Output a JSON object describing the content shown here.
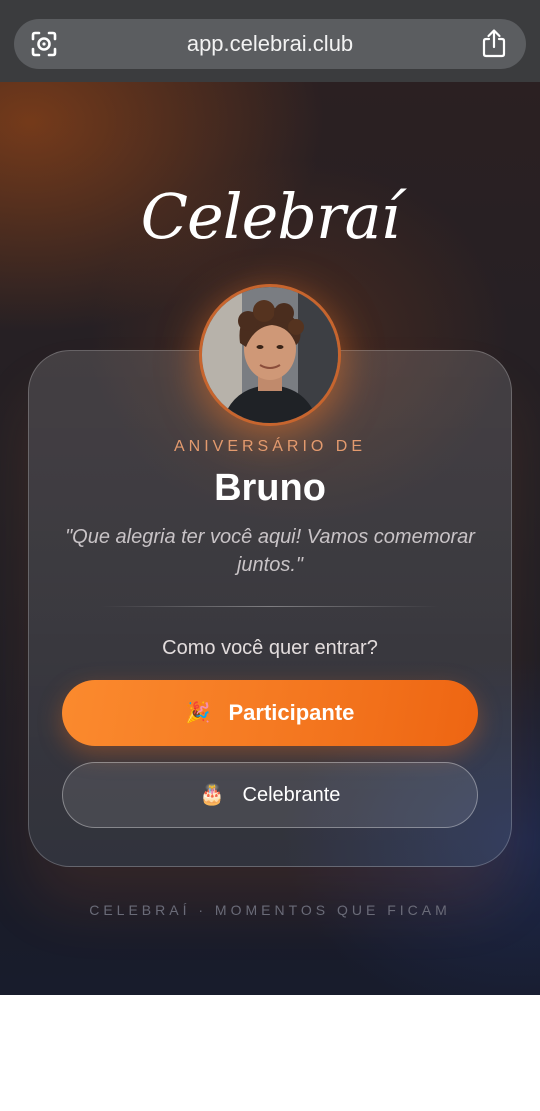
{
  "browser": {
    "url": "app.celebrai.club",
    "left_icon": "lens-icon",
    "right_icon": "share-icon"
  },
  "logo": "Celebraí",
  "card": {
    "eyebrow": "ANIVERSÁRIO DE",
    "name": "Bruno",
    "quote": "\"Que alegria ter você aqui! Vamos comemorar juntos.\"",
    "prompt": "Como você quer entrar?",
    "buttons": {
      "primary": {
        "label": "Participante",
        "icon": "party-popper-icon",
        "glyph": "🎉"
      },
      "secondary": {
        "label": "Celebrante",
        "icon": "cake-icon",
        "glyph": "🎂"
      }
    }
  },
  "footer": "CELEBRAÍ · MOMENTOS QUE FICAM",
  "colors": {
    "accent": "#F57A22",
    "eyebrow": "#E39A6E",
    "browser_bar": "#3B3C3E"
  }
}
